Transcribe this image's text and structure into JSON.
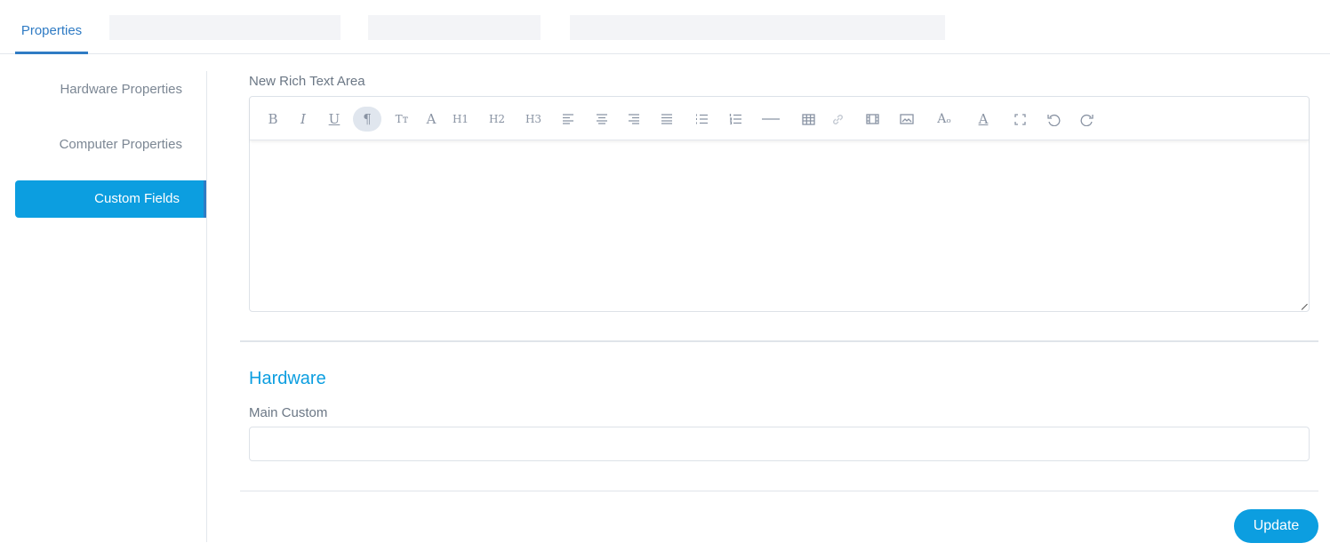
{
  "tabs": {
    "active": "Properties"
  },
  "sidebar": {
    "items": [
      {
        "label": "Hardware Properties"
      },
      {
        "label": "Computer Properties"
      },
      {
        "label": "Custom Fields",
        "active": true
      }
    ]
  },
  "editor": {
    "label": "New Rich Text Area",
    "value": "",
    "toolbar": [
      "bold",
      "italic",
      "underline",
      "paragraph",
      "font-size",
      "font-family",
      "h1",
      "h2",
      "h3",
      "align-left",
      "align-center",
      "align-right",
      "align-justify",
      "bullet-list",
      "numbered-list",
      "horizontal-rule",
      "table",
      "link",
      "video",
      "image",
      "clear-format",
      "text-color",
      "fullscreen",
      "undo",
      "redo"
    ],
    "glyphs": {
      "bold": "B",
      "italic": "I",
      "underline": "U",
      "paragraph": "¶",
      "font-size": "Tт",
      "font-family": "A",
      "h1": "H1",
      "h2": "H2",
      "h3": "H3",
      "clear-format": "Aₒ",
      "text-color": "A"
    }
  },
  "section": {
    "title": "Hardware",
    "field_label": "Main Custom",
    "field_value": ""
  },
  "actions": {
    "update": "Update"
  },
  "colors": {
    "accent": "#0c9ee0",
    "tab": "#2f7bc4"
  }
}
